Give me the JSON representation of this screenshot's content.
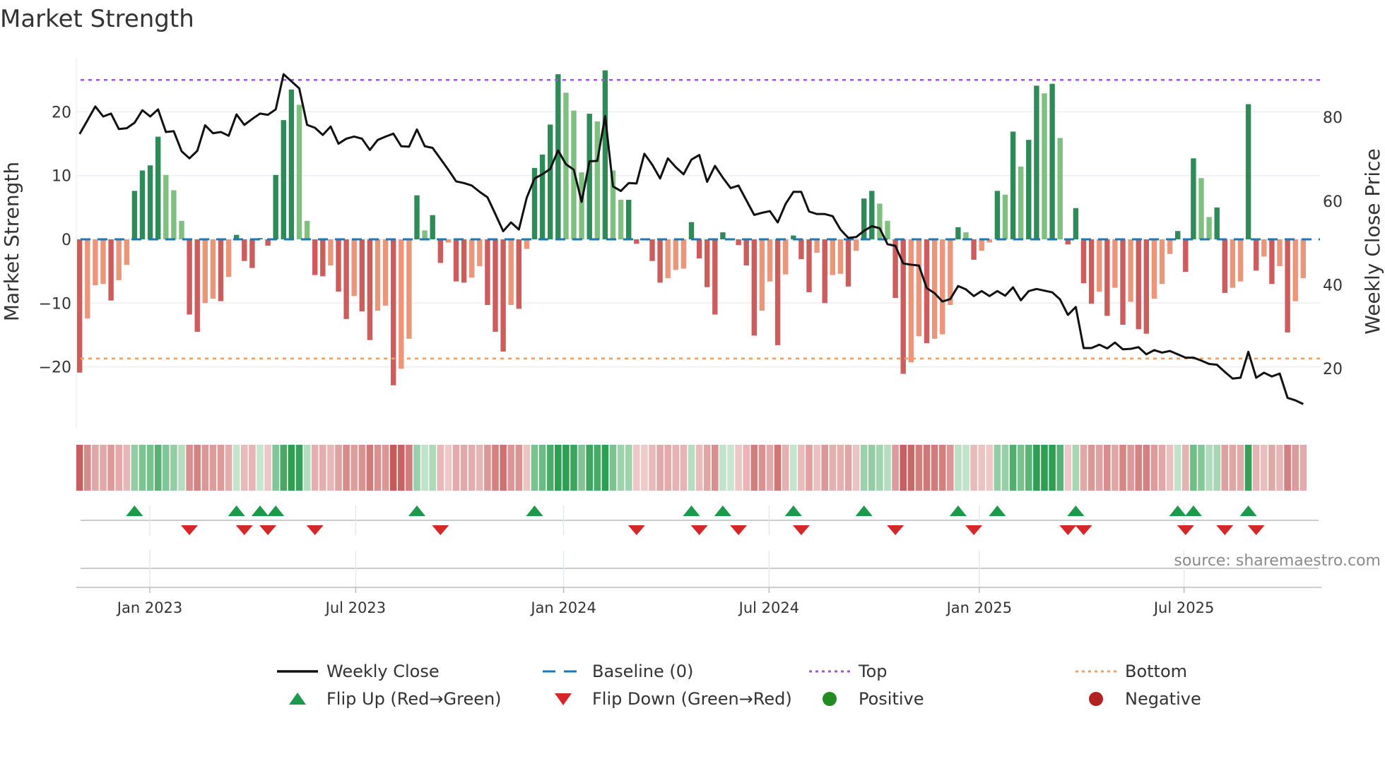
{
  "chart_data": {
    "type": "bar",
    "title": "Market Strength",
    "ylabel": "Market Strength",
    "y2label": "Weekly Close Price",
    "ylim": [
      -29.5,
      28.5
    ],
    "y2lim": [
      6,
      94
    ],
    "yticks": [
      20,
      10,
      0,
      -10,
      -20
    ],
    "yticks_text": [
      "20",
      "10",
      "0",
      "−10",
      "−20"
    ],
    "y2ticks": [
      80,
      60,
      40,
      20
    ],
    "y2ticks_text": [
      "80",
      "60",
      "40",
      "20"
    ],
    "top_level": 25.0,
    "bottom_level": -18.7,
    "baseline": 0,
    "grid": true,
    "xticks": [
      {
        "label": "Jan 2023",
        "week": 8.95
      },
      {
        "label": "Jul 2023",
        "week": 35.2
      },
      {
        "label": "Jan 2024",
        "week": 61.7
      },
      {
        "label": "Jul 2024",
        "week": 87.9
      },
      {
        "label": "Jan 2025",
        "week": 114.7
      },
      {
        "label": "Jul 2025",
        "week": 140.8
      }
    ],
    "strength": [
      -20.9,
      -12.4,
      -7.2,
      -7.0,
      -9.6,
      -6.4,
      -4.0,
      7.6,
      10.8,
      11.6,
      16.1,
      10.1,
      7.7,
      2.9,
      -11.8,
      -14.5,
      -10.0,
      -9.3,
      -9.7,
      -5.9,
      0.7,
      -3.4,
      -4.5,
      0.2,
      -1.0,
      10.1,
      18.7,
      23.5,
      21.1,
      2.9,
      -5.6,
      -5.8,
      -4.1,
      -8.2,
      -12.5,
      -8.9,
      -11.3,
      -15.8,
      -11.2,
      -10.4,
      -22.9,
      -20.3,
      -15.6,
      6.9,
      1.4,
      3.8,
      -3.7,
      -0.5,
      -6.6,
      -6.8,
      -6.0,
      -4.2,
      -10.3,
      -14.5,
      -17.6,
      -10.3,
      -10.9,
      -1.5,
      11.2,
      13.3,
      18.0,
      25.9,
      23.0,
      20.2,
      10.5,
      19.7,
      18.5,
      26.5,
      10.8,
      6.2,
      6.2,
      -0.7,
      -0.1,
      -3.4,
      -6.8,
      -6.1,
      -4.8,
      -4.6,
      2.7,
      -3.0,
      -7.5,
      -11.8,
      1.1,
      0.1,
      -0.9,
      -4.1,
      -15.1,
      -11.2,
      -6.6,
      -16.6,
      -5.5,
      0.6,
      -3.1,
      -8.3,
      -2.1,
      -10.0,
      -5.6,
      -5.4,
      -7.4,
      -1.8,
      6.4,
      7.6,
      5.6,
      2.9,
      -9.2,
      -21.1,
      -19.3,
      -15.2,
      -16.3,
      -15.6,
      -14.9,
      -10.3,
      1.9,
      1.1,
      -3.2,
      -1.8,
      -0.5,
      7.6,
      7.0,
      16.9,
      11.4,
      15.6,
      24.1,
      22.9,
      24.4,
      15.9,
      -0.8,
      4.9,
      -6.9,
      -10.1,
      -8.2,
      -12.0,
      -7.6,
      -13.4,
      -9.8,
      -14.1,
      -14.8,
      -9.3,
      -7.0,
      -2.3,
      1.3,
      -5.1,
      12.7,
      9.6,
      3.5,
      5.0,
      -8.4,
      -7.6,
      -6.6,
      21.2,
      -4.9,
      -2.7,
      -7.0,
      -4.2,
      -14.6,
      -9.7,
      -6.1
    ],
    "weekly_close": [
      76.0,
      79.3,
      82.6,
      80.2,
      80.9,
      77.2,
      77.4,
      78.7,
      81.7,
      80.2,
      81.9,
      76.5,
      76.7,
      71.9,
      70.2,
      72.0,
      78.1,
      76.2,
      76.5,
      75.6,
      80.7,
      78.2,
      79.6,
      80.9,
      80.6,
      81.9,
      90.3,
      88.6,
      86.9,
      78.2,
      77.5,
      75.8,
      77.8,
      73.7,
      74.9,
      75.4,
      74.9,
      72.2,
      74.6,
      75.4,
      76.1,
      73.1,
      73.0,
      77.1,
      73.1,
      72.7,
      70.1,
      67.5,
      64.7,
      64.3,
      63.7,
      62.2,
      60.9,
      56.9,
      52.8,
      54.9,
      53.2,
      60.8,
      65.4,
      66.4,
      67.7,
      72.1,
      68.8,
      67.5,
      59.8,
      69.5,
      69.6,
      80.3,
      63.5,
      62.4,
      64.3,
      64.2,
      71.3,
      68.7,
      65.4,
      70.2,
      68.1,
      66.4,
      69.9,
      71.0,
      64.6,
      68.4,
      65.6,
      63.1,
      63.7,
      60.2,
      56.7,
      57.2,
      57.6,
      54.9,
      59.3,
      62.2,
      62.2,
      57.5,
      56.9,
      56.9,
      56.4,
      53.2,
      51.2,
      51.4,
      52.9,
      54.0,
      53.5,
      49.7,
      49.3,
      45.1,
      44.8,
      44.6,
      39.2,
      38.0,
      36.0,
      36.6,
      39.7,
      38.9,
      37.3,
      38.5,
      37.3,
      38.5,
      37.4,
      39.4,
      36.3,
      38.5,
      39.0,
      38.6,
      38.2,
      36.5,
      32.8,
      34.7,
      24.9,
      24.9,
      25.7,
      24.8,
      26.2,
      24.6,
      24.7,
      25.1,
      23.4,
      24.4,
      23.8,
      24.2,
      23.4,
      22.6,
      22.6,
      21.9,
      21.1,
      20.9,
      19.2,
      17.6,
      17.8,
      24.0,
      17.8,
      19.0,
      18.1,
      18.8,
      13.0,
      12.4,
      11.5
    ],
    "legend": {
      "placement": "bottom",
      "items": [
        {
          "label": "Weekly Close",
          "kind": "line",
          "color": "#111111"
        },
        {
          "label": "Baseline (0)",
          "kind": "dash",
          "color": "#1f77b4"
        },
        {
          "label": "Top",
          "kind": "dot",
          "color": "#9b59d6"
        },
        {
          "label": "Bottom",
          "kind": "dot",
          "color": "#f0a060"
        },
        {
          "label": "Flip Up (Red→Green)",
          "kind": "up",
          "color": "#1a9a4a"
        },
        {
          "label": "Flip Down (Green→Red)",
          "kind": "down",
          "color": "#d62728"
        },
        {
          "label": "Positive",
          "kind": "circle",
          "color": "#228b22"
        },
        {
          "label": "Negative",
          "kind": "circle",
          "color": "#b22222"
        }
      ]
    },
    "colors": {
      "pos_strong": "#2e8b57",
      "pos_weak": "#7fbf7f",
      "neg_strong": "#cd5c5c",
      "neg_weak": "#e9967a",
      "flip_up": "#1a9a4a",
      "flip_down": "#d62728",
      "grid": "#eceef3",
      "axis": "#cccccc"
    }
  },
  "source": "source: sharemaestro.com"
}
